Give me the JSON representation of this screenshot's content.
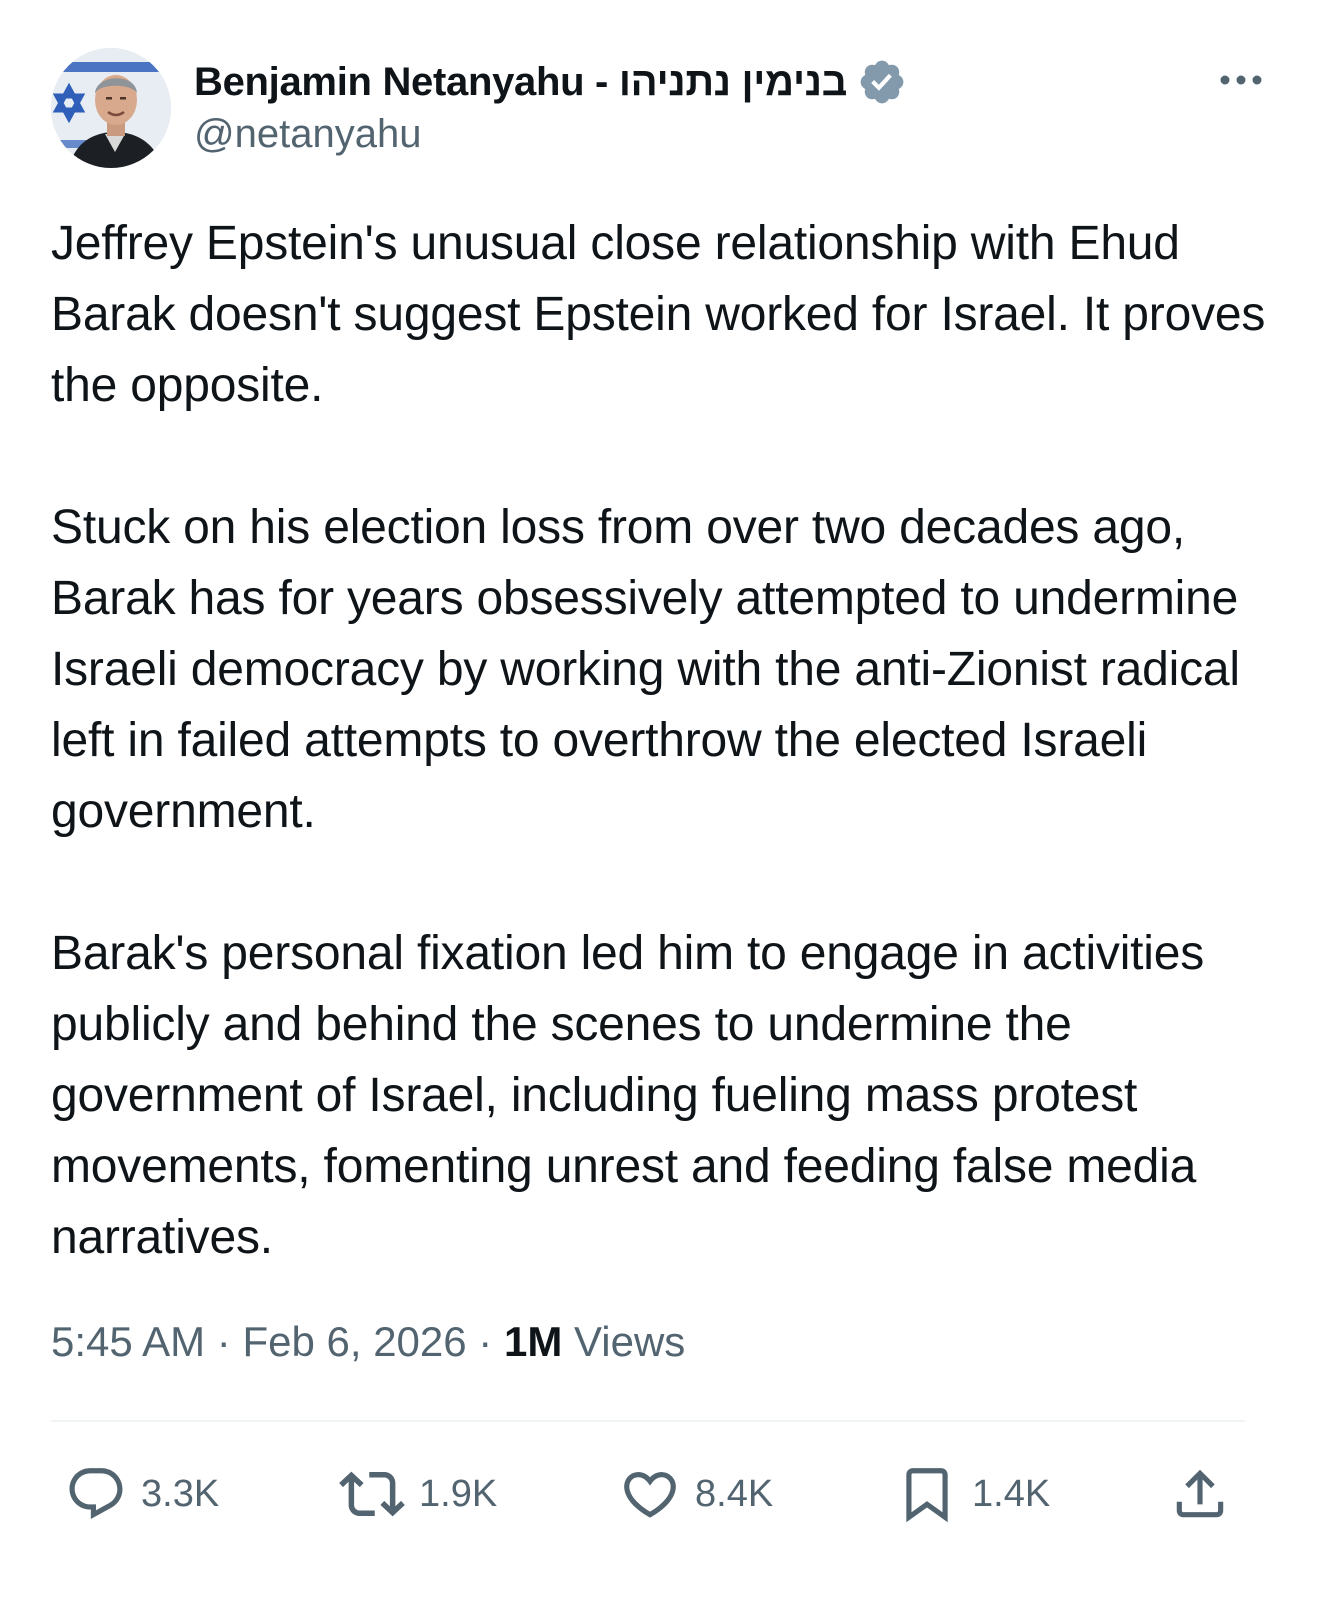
{
  "author": {
    "display_name": "Benjamin Netanyahu - בנימין נתניהו",
    "handle": "@netanyahu",
    "verified": true
  },
  "tweet": {
    "paragraphs": [
      "Jeffrey Epstein's unusual close relationship with Ehud Barak doesn't suggest Epstein worked for Israel. It proves the opposite.",
      "Stuck on his election loss from over two decades ago, Barak has for years obsessively attempted to undermine Israeli democracy by working with the anti-Zionist radical left in failed attempts to overthrow the elected Israeli government.",
      "Barak's personal fixation led him to engage in activities publicly and behind the scenes to undermine the government of Israel, including fueling mass protest movements, fomenting unrest and feeding false media narratives."
    ],
    "time": "5:45 AM",
    "date": "Feb 6, 2026",
    "views_count": "1M",
    "views_label": "Views",
    "separator": "·"
  },
  "actions": {
    "reply": {
      "icon": "reply-icon",
      "count": "3.3K"
    },
    "repost": {
      "icon": "repost-icon",
      "count": "1.9K"
    },
    "like": {
      "icon": "heart-icon",
      "count": "8.4K"
    },
    "bookmark": {
      "icon": "bookmark-icon",
      "count": "1.4K"
    },
    "share": {
      "icon": "share-icon"
    }
  },
  "colors": {
    "text_primary": "#0f1419",
    "text_secondary": "#536471",
    "verified_badge": "#829aab",
    "divider": "#eff3f4"
  }
}
